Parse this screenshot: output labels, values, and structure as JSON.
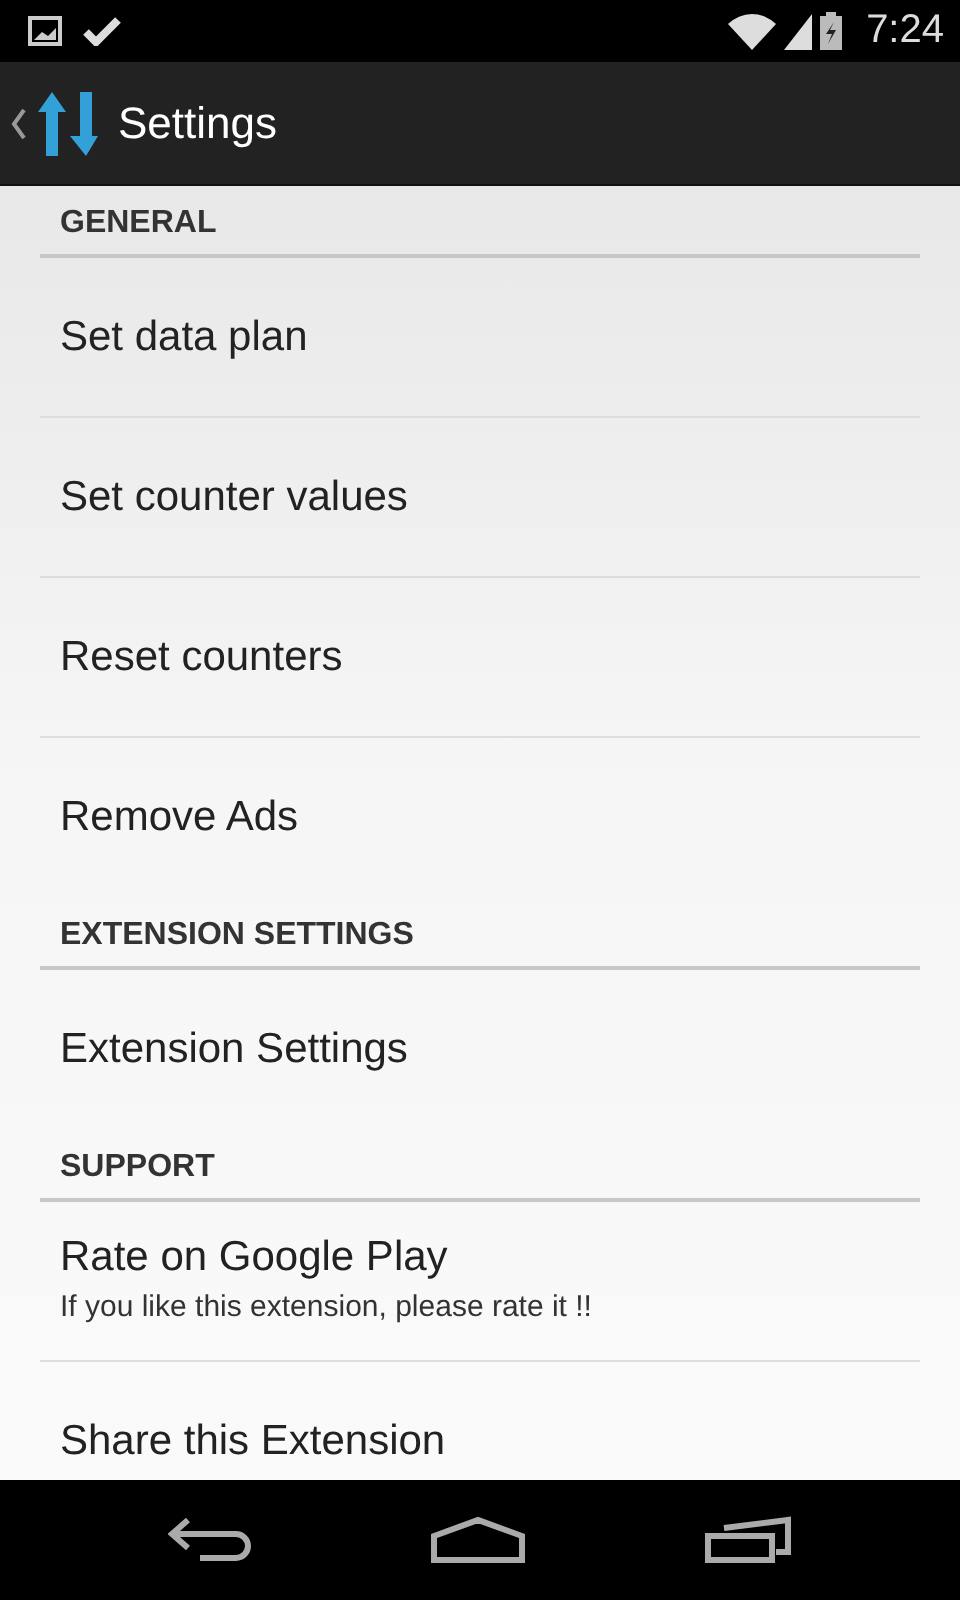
{
  "status_bar": {
    "time": "7:24"
  },
  "action_bar": {
    "title": "Settings"
  },
  "sections": [
    {
      "title": "GENERAL",
      "items": [
        {
          "title": "Set data plan"
        },
        {
          "title": "Set counter values"
        },
        {
          "title": "Reset counters"
        },
        {
          "title": "Remove Ads"
        }
      ]
    },
    {
      "title": "EXTENSION SETTINGS",
      "items": [
        {
          "title": "Extension Settings"
        }
      ]
    },
    {
      "title": "SUPPORT",
      "items": [
        {
          "title": "Rate on Google Play",
          "summary": "If you like this extension, please rate it !!"
        },
        {
          "title": "Share this Extension"
        }
      ]
    }
  ]
}
